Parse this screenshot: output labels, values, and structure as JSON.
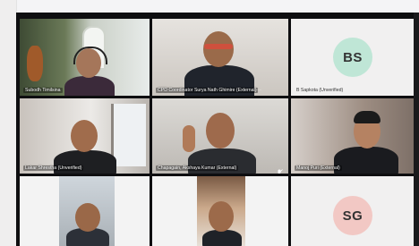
{
  "tiles": [
    {
      "name": "Subodh Timilsina",
      "type": "video"
    },
    {
      "name": "CPD Coordinator Surya Nath Ghimire (External)",
      "type": "video",
      "active": true
    },
    {
      "name": "B Sapkota (Unverified)",
      "type": "avatar",
      "initials": "BS",
      "avatar_color": "#bfe6d6"
    },
    {
      "name": "Lakar Shrestha (Unverified)",
      "type": "video"
    },
    {
      "name": "Chapagain, Akshaya Kumar (External)",
      "type": "video",
      "muted": true
    },
    {
      "name": "Manoj Puri (External)",
      "type": "video"
    },
    {
      "name": "",
      "type": "video"
    },
    {
      "name": "",
      "type": "video"
    },
    {
      "name": "",
      "type": "avatar",
      "initials": "SG",
      "avatar_color": "#f2c8c4"
    }
  ],
  "colors": {
    "active_outline": "#7b83eb",
    "tile_bg": "#2b2b2b",
    "label_text": "#ffffff"
  },
  "icons": {
    "more": "more-options-icon",
    "mute": "mic-off-icon"
  },
  "more_label": "···"
}
